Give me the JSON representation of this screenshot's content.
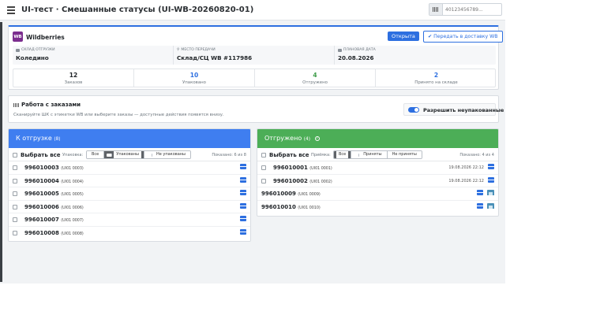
{
  "topbar": {
    "title": "UI-тест · Смешанные статусы (UI-WB-20260820-01)",
    "scan_placeholder": "40123456789..."
  },
  "header": {
    "logo_text": "WB",
    "brand": "Wildberries",
    "status": "Открыта",
    "transfer_label": "Передать в доставку WB",
    "info": [
      {
        "label": "Склад отгрузки",
        "value": "Коледино"
      },
      {
        "label": "Место передачи",
        "value": "Склад/СЦ WB #117986"
      },
      {
        "label": "Плановая дата",
        "value": "20.08.2026"
      }
    ],
    "stats": [
      {
        "value": "12",
        "label": "Заказов",
        "color": "#212529"
      },
      {
        "value": "10",
        "label": "Упаковано",
        "color": "#2d6fe0"
      },
      {
        "value": "4",
        "label": "Отгружено",
        "color": "#3f9d4a"
      },
      {
        "value": "2",
        "label": "Принято на складе",
        "color": "#2d6fe0"
      }
    ]
  },
  "work": {
    "title": "Работа с заказами",
    "hint": "Сканируйте ШК с этикетки WB или выберите заказы — доступные действия появятся внизу.",
    "allow_label": "Разрешить неупакованные",
    "allow_on": true
  },
  "left_panel": {
    "title": "К отгрузке",
    "count": "(8)",
    "select_all": "Выбрать все",
    "filter_label": "Упаковка:",
    "filters": [
      "Все",
      "Упакованы",
      "Не упакованы"
    ],
    "active_filter": 1,
    "shown": "Показано: 6 из 8",
    "orders": [
      {
        "num": "996010003",
        "sub": "(UI01 0003)"
      },
      {
        "num": "996010004",
        "sub": "(UI01 0004)"
      },
      {
        "num": "996010005",
        "sub": "(UI01 0005)"
      },
      {
        "num": "996010006",
        "sub": "(UI01 0006)"
      },
      {
        "num": "996010007",
        "sub": "(UI01 0007)"
      },
      {
        "num": "996010008",
        "sub": "(UI01 0008)"
      }
    ]
  },
  "right_panel": {
    "title": "Отгружено",
    "count": "(4)",
    "select_all": "Выбрать все",
    "filter_label": "Приёмка:",
    "filters": [
      "Все",
      "Приняты",
      "Не приняты"
    ],
    "active_filter": 0,
    "shown": "Показано: 4 из 4",
    "orders": [
      {
        "num": "996010001",
        "sub": "(UI01 0001)",
        "date": "19.08.2026 22:12",
        "checkbox": true,
        "accepted": false
      },
      {
        "num": "996010002",
        "sub": "(UI01 0002)",
        "date": "19.08.2026 22:12",
        "checkbox": true,
        "accepted": false
      },
      {
        "num": "996010009",
        "sub": "(UI01 0009)",
        "date": "",
        "checkbox": false,
        "accepted": true
      },
      {
        "num": "996010010",
        "sub": "(UI01 0010)",
        "date": "",
        "checkbox": false,
        "accepted": true
      }
    ]
  }
}
